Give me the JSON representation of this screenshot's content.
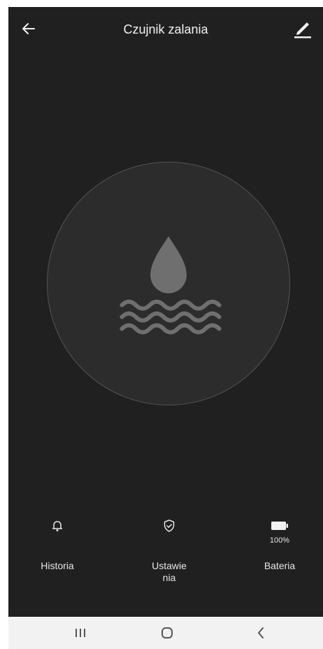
{
  "header": {
    "title": "Czujnik zalania",
    "back_icon": "arrow-left-icon",
    "edit_icon": "pencil-icon"
  },
  "sensor": {
    "icon": "water-drop-waves-icon"
  },
  "actions": [
    {
      "label": "Historia",
      "icon": "bell-icon"
    },
    {
      "label": "Ustawie nia",
      "icon": "shield-check-icon"
    },
    {
      "label": "Bateria",
      "icon": "battery-icon",
      "value": "100%"
    }
  ],
  "android_nav": {
    "recents_icon": "recent-apps-icon",
    "home_icon": "home-icon",
    "back_icon": "back-chevron-icon"
  },
  "colors": {
    "background": "#202020",
    "circle_fill": "#2c2c2c",
    "circle_border": "#545454",
    "icon_gray": "#6f6f6f",
    "text": "#f2f2f2",
    "nav_bar": "#f2f2f2"
  }
}
